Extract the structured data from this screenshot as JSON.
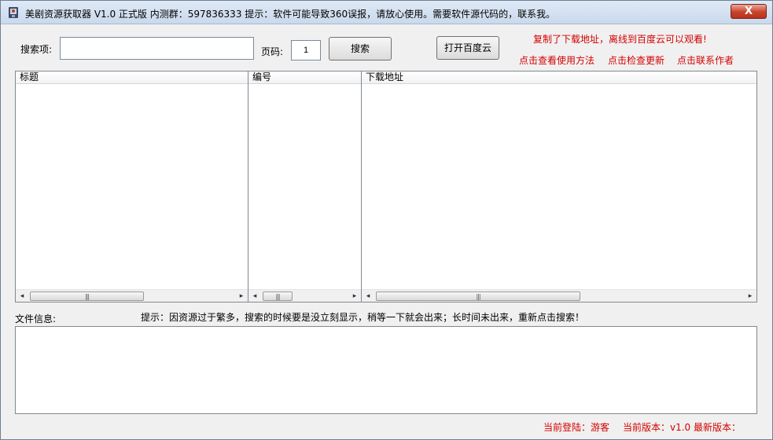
{
  "window": {
    "title": "美剧资源获取器 V1.0 正式版   内测群：597836333    提示：软件可能导致360误报，请放心使用。需要软件源代码的，联系我。",
    "close_symbol": "X"
  },
  "toolbar": {
    "search_label": "搜索项:",
    "search_value": "",
    "page_label": "页码:",
    "page_value": "1",
    "search_button": "搜索",
    "baidu_button": "打开百度云"
  },
  "notices": {
    "copy_hint": "复制了下载地址，离线到百度云可以观看!",
    "view_usage": "点击查看使用方法",
    "check_update": "点击检查更新",
    "contact_author": "点击联系作者"
  },
  "columns": {
    "title": "标题",
    "number": "编号",
    "download": "下载地址"
  },
  "file_info": {
    "label": "文件信息:",
    "hint": "提示：因资源过于繁多，搜索的时候要是没立刻显示，稍等一下就会出来；长时间未出来，重新点击搜索！"
  },
  "status": {
    "login": "当前登陆：游客",
    "current_version": "当前版本：v1.0",
    "latest_version": "最新版本："
  },
  "icons": {
    "scroll_left": "◂",
    "scroll_right": "▸",
    "grip": "|||"
  }
}
